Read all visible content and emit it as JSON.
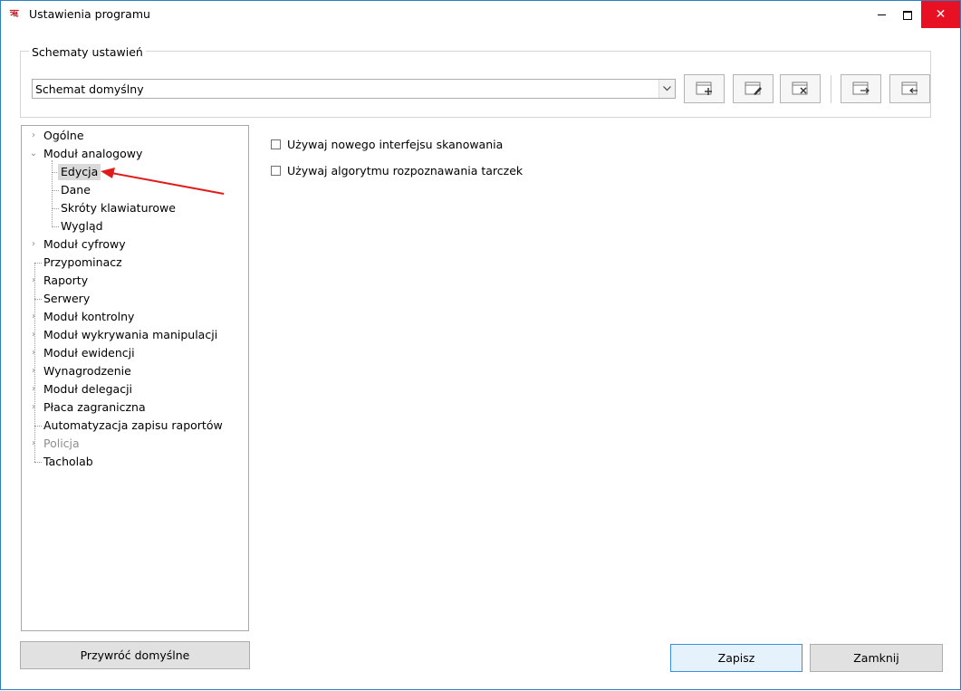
{
  "window": {
    "title": "Ustawienia programu",
    "app_icon_glyph": "ऋ",
    "minimize_glyph": "",
    "close_glyph": "✕"
  },
  "schemes": {
    "legend": "Schematy ustawień",
    "selected": "Schemat domyślny",
    "dropdown_arrow": "∨",
    "tool_buttons": [
      "new-scheme-icon",
      "edit-scheme-icon",
      "delete-scheme-icon",
      "export-scheme-icon",
      "import-scheme-icon"
    ]
  },
  "tree": {
    "items": [
      {
        "label": "Ogólne",
        "expander": "›",
        "level": 0
      },
      {
        "label": "Moduł analogowy",
        "expander": "⌄",
        "level": 0
      },
      {
        "label": "Edycja",
        "level": 1,
        "selected": true
      },
      {
        "label": "Dane",
        "level": 1
      },
      {
        "label": "Skróty klawiaturowe",
        "level": 1
      },
      {
        "label": "Wygląd",
        "level": 1
      },
      {
        "label": "Moduł cyfrowy",
        "expander": "›",
        "level": 0
      },
      {
        "label": "Przypominacz",
        "level": 0
      },
      {
        "label": "Raporty",
        "expander": "›",
        "level": 0
      },
      {
        "label": "Serwery",
        "level": 0
      },
      {
        "label": "Moduł kontrolny",
        "expander": "›",
        "level": 0
      },
      {
        "label": "Moduł wykrywania manipulacji",
        "expander": "›",
        "level": 0
      },
      {
        "label": "Moduł ewidencji",
        "expander": "›",
        "level": 0
      },
      {
        "label": "Wynagrodzenie",
        "expander": "›",
        "level": 0
      },
      {
        "label": "Moduł delegacji",
        "expander": "›",
        "level": 0
      },
      {
        "label": "Płaca zagraniczna",
        "expander": "›",
        "level": 0
      },
      {
        "label": "Automatyzacja zapisu raportów",
        "level": 0
      },
      {
        "label": "Policja",
        "expander": "›",
        "level": 0,
        "disabled": true
      },
      {
        "label": "Tacholab",
        "level": 0
      }
    ]
  },
  "options": {
    "use_new_scan_interface": {
      "label": "Używaj nowego interfejsu skanowania",
      "checked": false
    },
    "use_disc_recognition": {
      "label": "Używaj algorytmu rozpoznawania tarczek",
      "checked": false
    }
  },
  "buttons": {
    "restore_defaults": "Przywróć domyślne",
    "save": "Zapisz",
    "close": "Zamknij"
  },
  "colors": {
    "accent_border": "#2d7fc4",
    "close_button": "#e81123",
    "annotation_arrow": "#e01b1b",
    "selection": "#d9d9d9"
  }
}
